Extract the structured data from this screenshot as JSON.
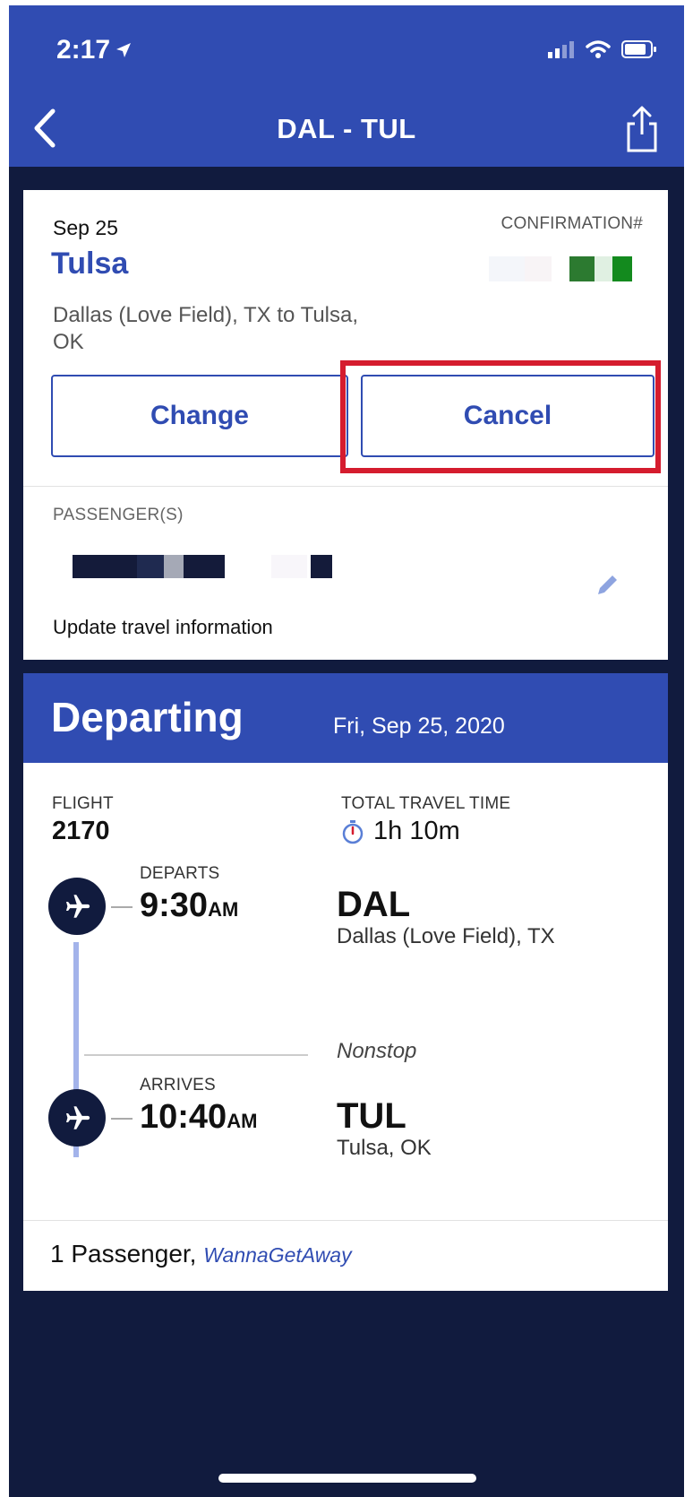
{
  "status_bar": {
    "time": "2:17"
  },
  "header": {
    "title": "DAL - TUL"
  },
  "trip": {
    "date": "Sep 25",
    "destination": "Tulsa",
    "route": "Dallas (Love Field), TX to Tulsa, OK",
    "confirmation_label": "CONFIRMATION#",
    "change_label": "Change",
    "cancel_label": "Cancel",
    "passengers_label": "PASSENGER(S)",
    "update_label": "Update travel information"
  },
  "flight": {
    "section_title": "Departing",
    "section_date": "Fri, Sep 25, 2020",
    "flight_label": "FLIGHT",
    "flight_number": "2170",
    "travel_time_label": "TOTAL TRAVEL TIME",
    "travel_time": "1h 10m",
    "departs_label": "DEPARTS",
    "depart_time": "9:30",
    "depart_ampm": "AM",
    "depart_code": "DAL",
    "depart_city": "Dallas (Love Field), TX",
    "nonstop": "Nonstop",
    "arrives_label": "ARRIVES",
    "arrive_time": "10:40",
    "arrive_ampm": "AM",
    "arrive_code": "TUL",
    "arrive_city": "Tulsa, OK",
    "passenger_count": "1 Passenger,",
    "fare_type": "WannaGetAway"
  },
  "colors": {
    "brand_blue": "#304cb2",
    "dark_navy": "#111b3e",
    "highlight_red": "#d51c2e"
  },
  "icons": [
    "location-arrow-icon",
    "cellular-signal-icon",
    "wifi-icon",
    "battery-icon",
    "chevron-left-icon",
    "share-icon",
    "pencil-icon",
    "stopwatch-icon",
    "airplane-icon"
  ]
}
